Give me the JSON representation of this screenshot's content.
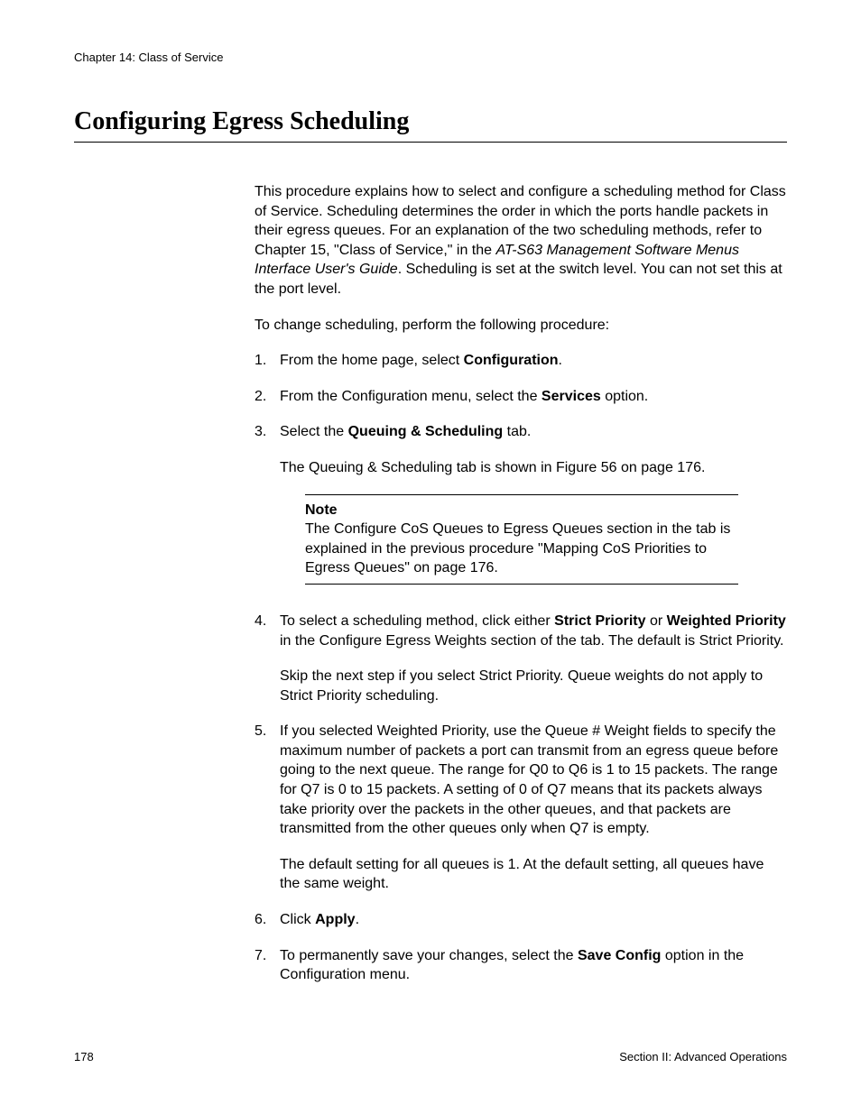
{
  "header": {
    "chapter": "Chapter 14: Class of Service"
  },
  "title": "Configuring Egress Scheduling",
  "intro": {
    "p1_a": "This procedure explains how to select and configure a scheduling method for Class of Service. Scheduling determines the order in which the ports handle packets in their egress queues. For an explanation of the two scheduling methods, refer to Chapter 15, \"Class of Service,\" in the ",
    "p1_i": "AT-S63 Management Software Menus Interface User's Guide",
    "p1_b": ". Scheduling is set at the switch level. You can not set this at the port level.",
    "p2": "To change scheduling, perform the following procedure:"
  },
  "steps": {
    "s1_a": "From the home page, select ",
    "s1_b": "Configuration",
    "s1_c": ".",
    "s2_a": "From the Configuration menu, select the ",
    "s2_b": "Services",
    "s2_c": " option.",
    "s3_a": "Select the ",
    "s3_b": "Queuing & Scheduling",
    "s3_c": " tab.",
    "s3_sub": "The Queuing & Scheduling tab is shown in Figure 56 on page 176.",
    "s4_a": "To select a scheduling method, click either ",
    "s4_b": "Strict Priority",
    "s4_c": " or ",
    "s4_d": "Weighted Priority",
    "s4_e": " in the Configure Egress Weights section of the tab. The default is Strict Priority.",
    "s4_sub": "Skip the next step if you select Strict Priority. Queue weights do not apply to Strict Priority scheduling.",
    "s5": "If you selected Weighted Priority, use the Queue # Weight fields to specify the maximum number of packets a port can transmit from an egress queue before going to the next queue. The range for Q0 to Q6 is 1 to 15 packets. The range for Q7 is 0 to 15 packets. A setting of 0 of Q7 means that its packets always take priority over the packets in the other queues, and that packets are transmitted from the other queues only when Q7 is empty.",
    "s5_sub": "The default setting for all queues is 1. At the default setting, all queues have the same weight.",
    "s6_a": "Click ",
    "s6_b": "Apply",
    "s6_c": ".",
    "s7_a": "To permanently save your changes, select the ",
    "s7_b": "Save Config",
    "s7_c": " option in the Configuration menu."
  },
  "note": {
    "title": "Note",
    "text": "The Configure CoS Queues to Egress Queues section in the tab is explained in the previous procedure \"Mapping CoS Priorities to Egress Queues\" on page 176."
  },
  "footer": {
    "page": "178",
    "section": "Section II: Advanced Operations"
  },
  "nums": {
    "n1": "1.",
    "n2": "2.",
    "n3": "3.",
    "n4": "4.",
    "n5": "5.",
    "n6": "6.",
    "n7": "7."
  }
}
